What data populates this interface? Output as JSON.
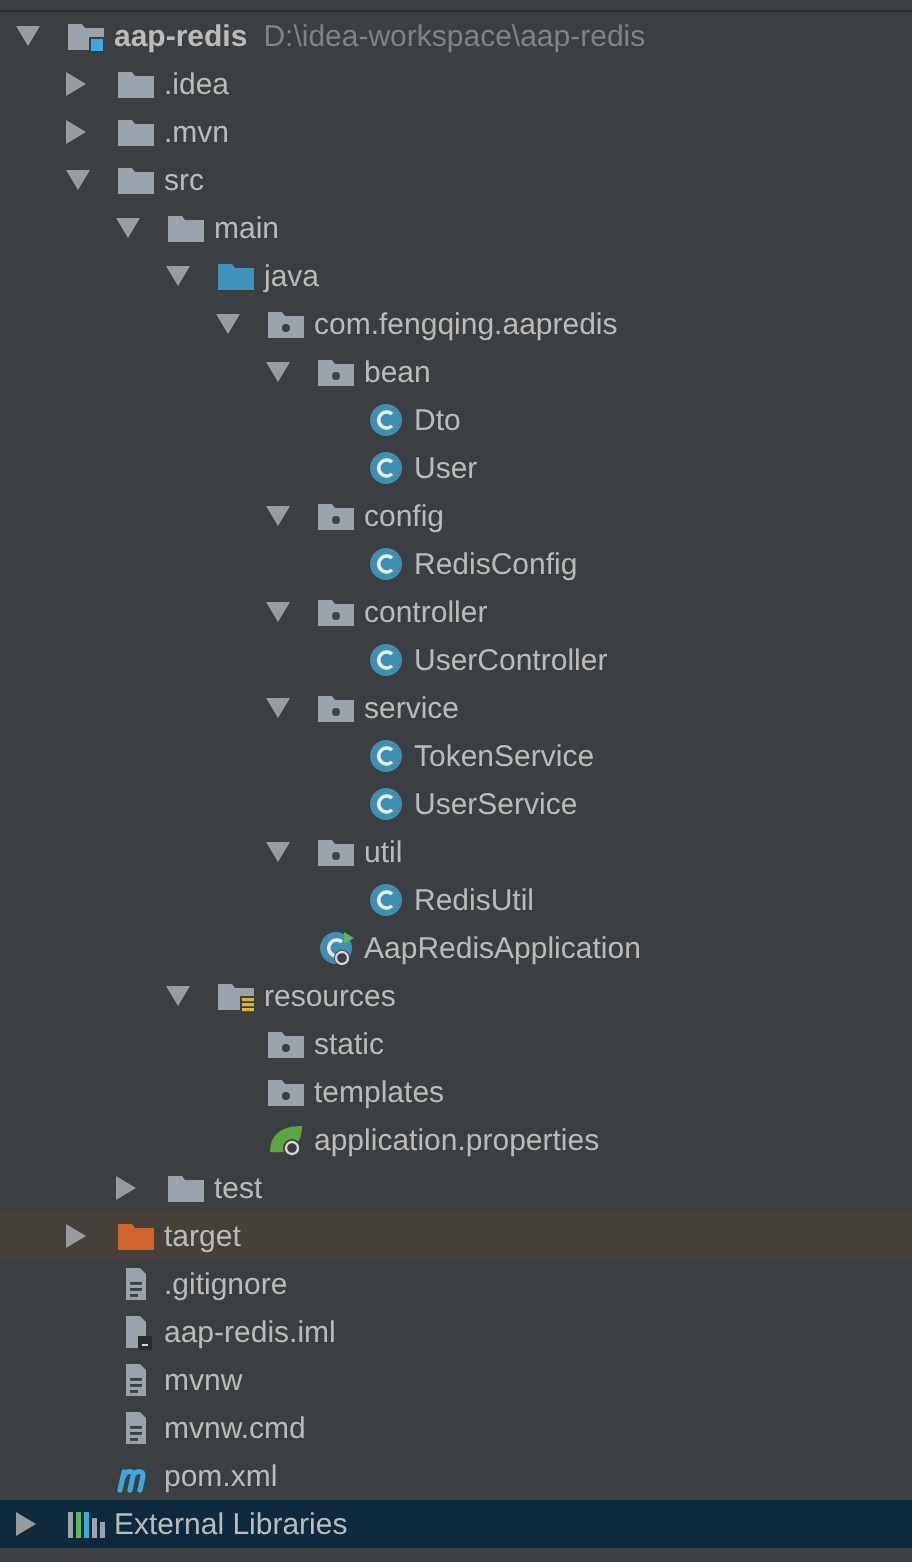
{
  "tree": [
    {
      "name": "aap-redis",
      "path": "D:\\idea-workspace\\aap-redis",
      "kind": "module",
      "expanded": true,
      "selected": false,
      "children": [
        {
          "name": ".idea",
          "kind": "folder",
          "expanded": false,
          "selected": false
        },
        {
          "name": ".mvn",
          "kind": "folder",
          "expanded": false,
          "selected": false
        },
        {
          "name": "src",
          "kind": "folder",
          "expanded": true,
          "selected": false,
          "children": [
            {
              "name": "main",
              "kind": "folder",
              "expanded": true,
              "selected": false,
              "children": [
                {
                  "name": "java",
                  "kind": "source",
                  "expanded": true,
                  "selected": false,
                  "children": [
                    {
                      "name": "com.fengqing.aapredis",
                      "kind": "package",
                      "expanded": true,
                      "selected": false,
                      "children": [
                        {
                          "name": "bean",
                          "kind": "package",
                          "expanded": true,
                          "selected": false,
                          "children": [
                            {
                              "name": "Dto",
                              "kind": "class",
                              "selected": false
                            },
                            {
                              "name": "User",
                              "kind": "class",
                              "selected": false
                            }
                          ]
                        },
                        {
                          "name": "config",
                          "kind": "package",
                          "expanded": true,
                          "selected": false,
                          "children": [
                            {
                              "name": "RedisConfig",
                              "kind": "class",
                              "selected": false
                            }
                          ]
                        },
                        {
                          "name": "controller",
                          "kind": "package",
                          "expanded": true,
                          "selected": false,
                          "children": [
                            {
                              "name": "UserController",
                              "kind": "class",
                              "selected": false
                            }
                          ]
                        },
                        {
                          "name": "service",
                          "kind": "package",
                          "expanded": true,
                          "selected": false,
                          "children": [
                            {
                              "name": "TokenService",
                              "kind": "class",
                              "selected": false
                            },
                            {
                              "name": "UserService",
                              "kind": "class",
                              "selected": false
                            }
                          ]
                        },
                        {
                          "name": "util",
                          "kind": "package",
                          "expanded": true,
                          "selected": false,
                          "children": [
                            {
                              "name": "RedisUtil",
                              "kind": "class",
                              "selected": false
                            }
                          ]
                        },
                        {
                          "name": "AapRedisApplication",
                          "kind": "boot-class",
                          "selected": false
                        }
                      ]
                    }
                  ]
                },
                {
                  "name": "resources",
                  "kind": "resources",
                  "expanded": true,
                  "selected": false,
                  "children": [
                    {
                      "name": "static",
                      "kind": "package",
                      "selected": false
                    },
                    {
                      "name": "templates",
                      "kind": "package",
                      "selected": false
                    },
                    {
                      "name": "application.properties",
                      "kind": "spring-properties",
                      "selected": false
                    }
                  ]
                }
              ]
            },
            {
              "name": "test",
              "kind": "folder",
              "expanded": false,
              "selected": false
            }
          ]
        },
        {
          "name": "target",
          "kind": "excluded",
          "expanded": false,
          "selected": false
        },
        {
          "name": ".gitignore",
          "kind": "file",
          "selected": false
        },
        {
          "name": "aap-redis.iml",
          "kind": "iml",
          "selected": false
        },
        {
          "name": "mvnw",
          "kind": "file",
          "selected": false
        },
        {
          "name": "mvnw.cmd",
          "kind": "file",
          "selected": false
        },
        {
          "name": "pom.xml",
          "kind": "maven",
          "selected": false
        }
      ]
    },
    {
      "name": "External Libraries",
      "kind": "libraries",
      "expanded": false,
      "selected": true
    }
  ]
}
